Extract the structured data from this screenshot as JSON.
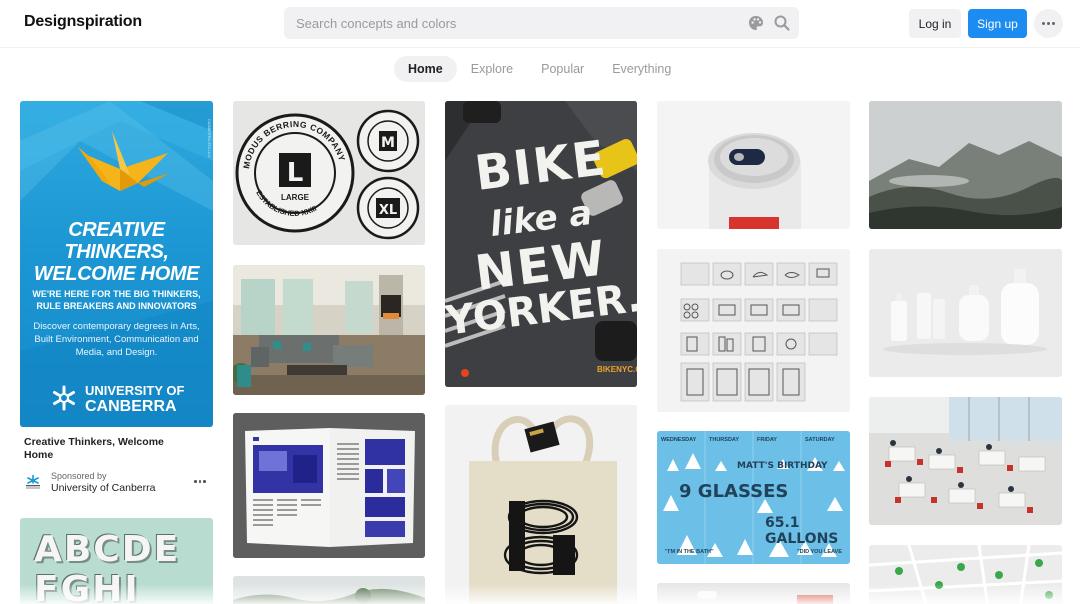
{
  "header": {
    "logo": "Designspiration",
    "search_placeholder": "Search concepts and colors",
    "search_value": "",
    "palette_icon": "palette-icon",
    "search_icon": "search-icon",
    "login_label": "Log in",
    "signup_label": "Sign up",
    "more_icon": "more-horizontal-icon"
  },
  "tabs": [
    {
      "label": "Home",
      "active": true
    },
    {
      "label": "Explore",
      "active": false
    },
    {
      "label": "Popular",
      "active": false
    },
    {
      "label": "Everything",
      "active": false
    }
  ],
  "ad": {
    "headline_line1": "CREATIVE THINKERS,",
    "headline_line2": "WELCOME HOME",
    "sub_line1": "WE'RE HERE FOR THE BIG THINKERS,",
    "sub_line2": "RULE BREAKERS AND INNOVATORS",
    "body": "Discover contemporary degrees in Arts, Built Environment, Communication and Media, and Design.",
    "university_line1": "UNIVERSITY OF",
    "university_line2": "CANBERRA",
    "caption": "Creative Thinkers, Welcome Home",
    "sponsored_by": "Sponsored by",
    "sponsor_name": "University of Canberra"
  },
  "pins": {
    "abc_line1": "ABCDE",
    "abc_line2": "FGHI",
    "bike_line1": "BIKE",
    "bike_line2": "like a",
    "bike_line3": "NEW",
    "bike_line4": "YORKER.",
    "bike_url": "BIKENYC.ORG",
    "badge_top": "MODUS BERRING COMPANY",
    "badge_L": "L",
    "badge_large": "LARGE",
    "badge_bottom": "ESTABLISHED XXIII",
    "badge_M": "M",
    "badge_XL": "XL",
    "poster_day1": "WEDNESDAY",
    "poster_day2": "THURSDAY",
    "poster_day3": "FRIDAY",
    "poster_day4": "SATURDAY",
    "poster_birthday": "MATT'S BIRTHDAY",
    "poster_glasses": "9 GLASSES",
    "poster_gallons": "65.1 GALLONS",
    "poster_bath": "\"I'M IN THE BATH\"",
    "poster_leave": "\"DID YOU LEAVE"
  },
  "colors": {
    "accent": "#1d8cf0",
    "ad_blue": "#1c97d3",
    "poster_blue": "#6cc0e8",
    "crane_yellow": "#f5b419"
  }
}
